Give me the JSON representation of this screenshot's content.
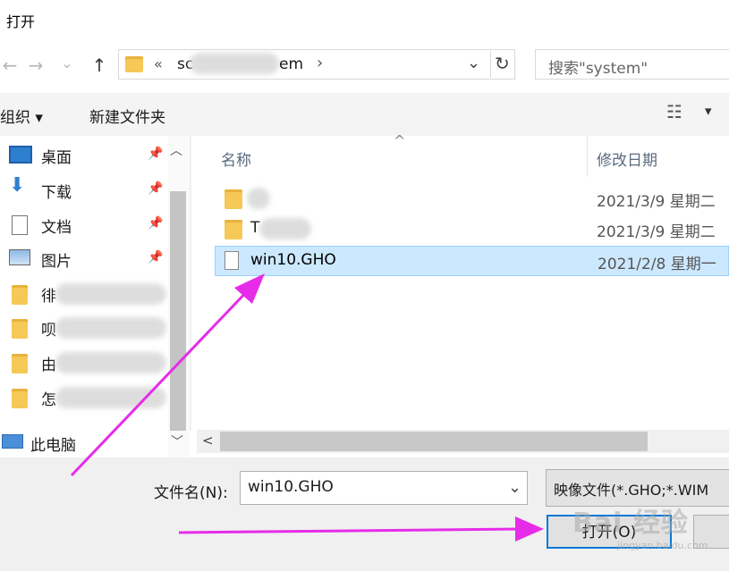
{
  "window": {
    "title": "打开"
  },
  "nav": {
    "back_glyph": "←",
    "forward_glyph": "→",
    "down_glyph": "⌄",
    "up_glyph": "↑"
  },
  "address": {
    "chevron_left": "«",
    "part1": "sc",
    "part2": "em",
    "chevron_right": "›",
    "dropdown": "⌄",
    "refresh": "↻"
  },
  "search": {
    "placeholder": "搜索\"system\""
  },
  "toolbar": {
    "organize": "组织 ▾",
    "new_folder": "新建文件夹",
    "view_glyph": "☷",
    "view_dropdown": "▾"
  },
  "sidebar": {
    "items": [
      {
        "label": "桌面",
        "icon": "desktop-icon"
      },
      {
        "label": "下载",
        "icon": "download-icon"
      },
      {
        "label": "文档",
        "icon": "document-icon"
      },
      {
        "label": "图片",
        "icon": "pictures-icon"
      },
      {
        "label": "徘",
        "icon": "folder-icon"
      },
      {
        "label": "呗",
        "icon": "folder-icon"
      },
      {
        "label": "由",
        "icon": "folder-icon"
      },
      {
        "label": "怎",
        "icon": "folder-icon"
      }
    ],
    "this_pc": "此电脑",
    "pin_glyph": "📌"
  },
  "columns": {
    "name": "名称",
    "modified": "修改日期",
    "sort_glyph": "^"
  },
  "files": [
    {
      "name": "",
      "date": "2021/3/9 星期二",
      "icon": "folder-icon"
    },
    {
      "name": "T",
      "date": "2021/3/9 星期二",
      "icon": "folder-icon"
    },
    {
      "name": "win10.GHO",
      "date": "2021/2/8 星期一",
      "icon": "file-icon"
    }
  ],
  "footer": {
    "filename_label": "文件名(N):",
    "filename_value": "win10.GHO",
    "filter_label": "映像文件(*.GHO;*.WIM",
    "open_button": "打开(O)",
    "cancel_button": "",
    "dropdown": "⌄"
  },
  "overlay": {
    "watermark": "Bai 经验",
    "watermark_sub": "jingyan.baidu.com"
  },
  "colors": {
    "arrow": "#e62ce8",
    "selection": "#cce8ff",
    "folder": "#f6c858"
  }
}
